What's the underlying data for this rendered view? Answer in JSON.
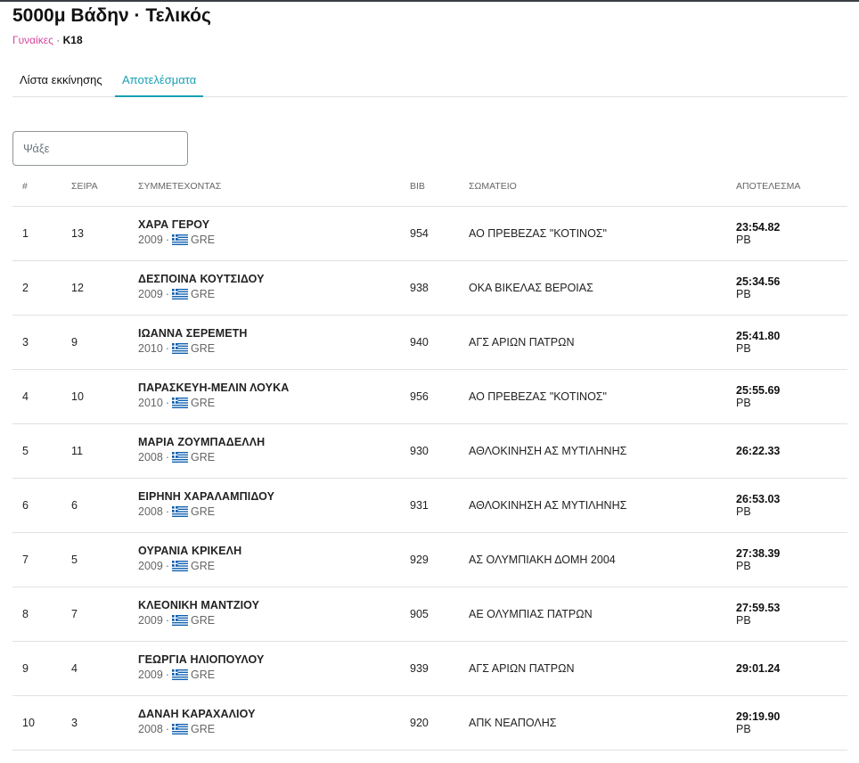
{
  "event": {
    "title": "5000μ Βάδην · Τελικός",
    "gender": "Γυναίκες",
    "separator": "·",
    "category": "Κ18"
  },
  "tabs": [
    {
      "label": "Λίστα εκκίνησης",
      "active": false
    },
    {
      "label": "Αποτελέσματα",
      "active": true
    }
  ],
  "search": {
    "placeholder": "Ψάξε",
    "value": ""
  },
  "columns": {
    "rank": "#",
    "heat": "ΣΕΙΡΑ",
    "athlete": "ΣΥΜΜΕΤΕΧΟΝΤΑΣ",
    "bib": "BIB",
    "club": "ΣΩΜΑΤΕΙΟ",
    "result": "ΑΠΟΤΕΛΕΣΜΑ"
  },
  "colors": {
    "accent": "#17a0b4",
    "gender": "#d3479d",
    "flag_blue": "#0d5eaf"
  },
  "rows": [
    {
      "rank": "1",
      "heat": "13",
      "name": "ΧΑΡΑ ΓΕΡΟΥ",
      "year": "2009",
      "country": "GRE",
      "flag_icon": "greece-flag-icon",
      "bib": "954",
      "club": "ΑΟ ΠΡΕΒΕΖΑΣ \"ΚΟΤΙΝΟΣ\"",
      "result": "23:54.82",
      "note": "PB"
    },
    {
      "rank": "2",
      "heat": "12",
      "name": "ΔΕΣΠΟΙΝΑ ΚΟΥΤΣΙΔΟΥ",
      "year": "2009",
      "country": "GRE",
      "flag_icon": "greece-flag-icon",
      "bib": "938",
      "club": "ΟΚΑ ΒΙΚΕΛΑΣ ΒΕΡΟΙΑΣ",
      "result": "25:34.56",
      "note": "PB"
    },
    {
      "rank": "3",
      "heat": "9",
      "name": "ΙΩΑΝΝΑ ΣΕΡΕΜΕΤΗ",
      "year": "2010",
      "country": "GRE",
      "flag_icon": "greece-flag-icon",
      "bib": "940",
      "club": "ΑΓΣ ΑΡΙΩΝ ΠΑΤΡΩΝ",
      "result": "25:41.80",
      "note": "PB"
    },
    {
      "rank": "4",
      "heat": "10",
      "name": "ΠΑΡΑΣΚΕΥΗ-ΜΕΛΙΝ ΛΟΥΚΑ",
      "year": "2010",
      "country": "GRE",
      "flag_icon": "greece-flag-icon",
      "bib": "956",
      "club": "ΑΟ ΠΡΕΒΕΖΑΣ \"ΚΟΤΙΝΟΣ\"",
      "result": "25:55.69",
      "note": "PB"
    },
    {
      "rank": "5",
      "heat": "11",
      "name": "ΜΑΡΙΑ ΖΟΥΜΠΑΔΕΛΛΗ",
      "year": "2008",
      "country": "GRE",
      "flag_icon": "greece-flag-icon",
      "bib": "930",
      "club": "ΑΘΛΟΚΙΝΗΣΗ ΑΣ ΜΥΤΙΛΗΝΗΣ",
      "result": "26:22.33",
      "note": ""
    },
    {
      "rank": "6",
      "heat": "6",
      "name": "ΕΙΡΗΝΗ ΧΑΡΑΛΑΜΠΙΔΟΥ",
      "year": "2008",
      "country": "GRE",
      "flag_icon": "greece-flag-icon",
      "bib": "931",
      "club": "ΑΘΛΟΚΙΝΗΣΗ ΑΣ ΜΥΤΙΛΗΝΗΣ",
      "result": "26:53.03",
      "note": "PB"
    },
    {
      "rank": "7",
      "heat": "5",
      "name": "ΟΥΡΑΝΙΑ ΚΡΙΚΕΛΗ",
      "year": "2009",
      "country": "GRE",
      "flag_icon": "greece-flag-icon",
      "bib": "929",
      "club": "ΑΣ ΟΛΥΜΠΙΑΚΗ ΔΟΜΗ 2004",
      "result": "27:38.39",
      "note": "PB"
    },
    {
      "rank": "8",
      "heat": "7",
      "name": "ΚΛΕΟΝΙΚΗ ΜΑΝΤΖΙΟΥ",
      "year": "2009",
      "country": "GRE",
      "flag_icon": "greece-flag-icon",
      "bib": "905",
      "club": "ΑΕ ΟΛΥΜΠΙΑΣ ΠΑΤΡΩΝ",
      "result": "27:59.53",
      "note": "PB"
    },
    {
      "rank": "9",
      "heat": "4",
      "name": "ΓΕΩΡΓΙΑ ΗΛΙΟΠΟΥΛΟΥ",
      "year": "2009",
      "country": "GRE",
      "flag_icon": "greece-flag-icon",
      "bib": "939",
      "club": "ΑΓΣ ΑΡΙΩΝ ΠΑΤΡΩΝ",
      "result": "29:01.24",
      "note": ""
    },
    {
      "rank": "10",
      "heat": "3",
      "name": "ΔΑΝΑΗ ΚΑΡΑΧΑΛΙΟΥ",
      "year": "2008",
      "country": "GRE",
      "flag_icon": "greece-flag-icon",
      "bib": "920",
      "club": "ΑΠΚ ΝΕΑΠΟΛΗΣ",
      "result": "29:19.90",
      "note": "PB"
    }
  ]
}
